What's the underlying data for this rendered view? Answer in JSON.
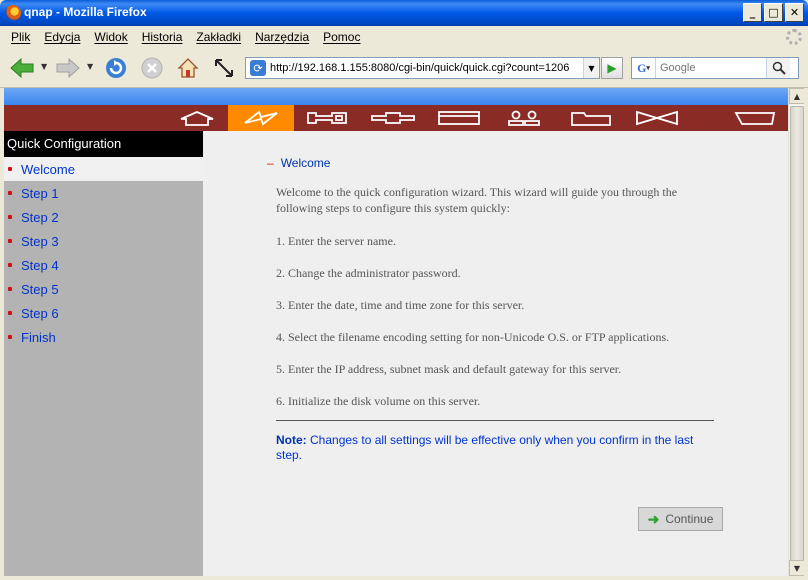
{
  "window": {
    "title": "qnap - Mozilla Firefox"
  },
  "menu": [
    "Plik",
    "Edycja",
    "Widok",
    "Historia",
    "Zakładki",
    "Narzędzia",
    "Pomoc"
  ],
  "address": {
    "url": "http://192.168.1.155:8080/cgi-bin/quick/quick.cgi?count=1206"
  },
  "search": {
    "placeholder": "Google"
  },
  "sidebar": {
    "header": "Quick Configuration",
    "items": [
      {
        "label": "Welcome",
        "active": true
      },
      {
        "label": "Step 1"
      },
      {
        "label": "Step 2"
      },
      {
        "label": "Step 3"
      },
      {
        "label": "Step 4"
      },
      {
        "label": "Step 5"
      },
      {
        "label": "Step 6"
      },
      {
        "label": "Finish"
      }
    ]
  },
  "main": {
    "breadcrumb": "Welcome",
    "intro": "Welcome to the quick configuration wizard. This wizard will guide you through the following steps to configure this system quickly:",
    "steps": [
      "1. Enter the server name.",
      "2. Change the administrator password.",
      "3. Enter the date, time and time zone for this server.",
      "4. Select the filename encoding setting for non-Unicode O.S. or FTP applications.",
      "5. Enter the IP address, subnet mask and default gateway for this server.",
      "6. Initialize the disk volume on this server."
    ],
    "note_label": "Note:",
    "note_text": " Changes to all settings will be effective only when you confirm in the last step.",
    "continue_label": "Continue"
  },
  "colors": {
    "nav_bar": "#8b2b26",
    "nav_active": "#ff8a00",
    "link": "#0033cc"
  }
}
